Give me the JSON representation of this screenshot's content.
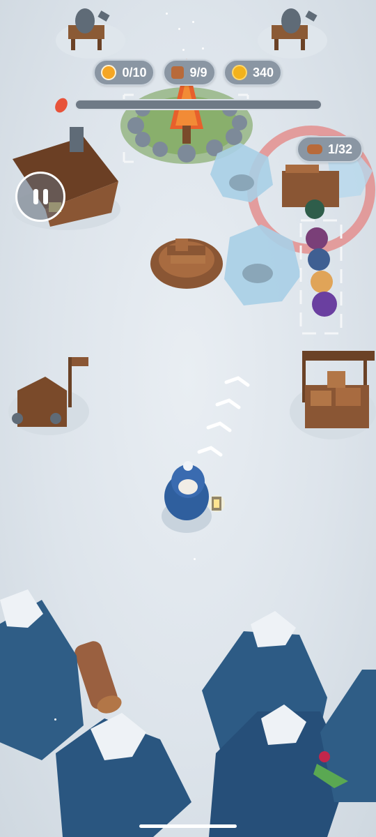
{
  "hud": {
    "people_counter": "0/10",
    "wood_counter": "9/9",
    "coins": "340",
    "queue_counter": "1/32",
    "fire_progress": 0.0,
    "colors": {
      "coin": "#f2b21c",
      "people": "#f5a623",
      "wood": "#b86a3a",
      "fire_icon": "#e8533a",
      "pill_bg": "#8a96a3"
    }
  },
  "buttons": {
    "pause_icon": "pause-icon"
  }
}
